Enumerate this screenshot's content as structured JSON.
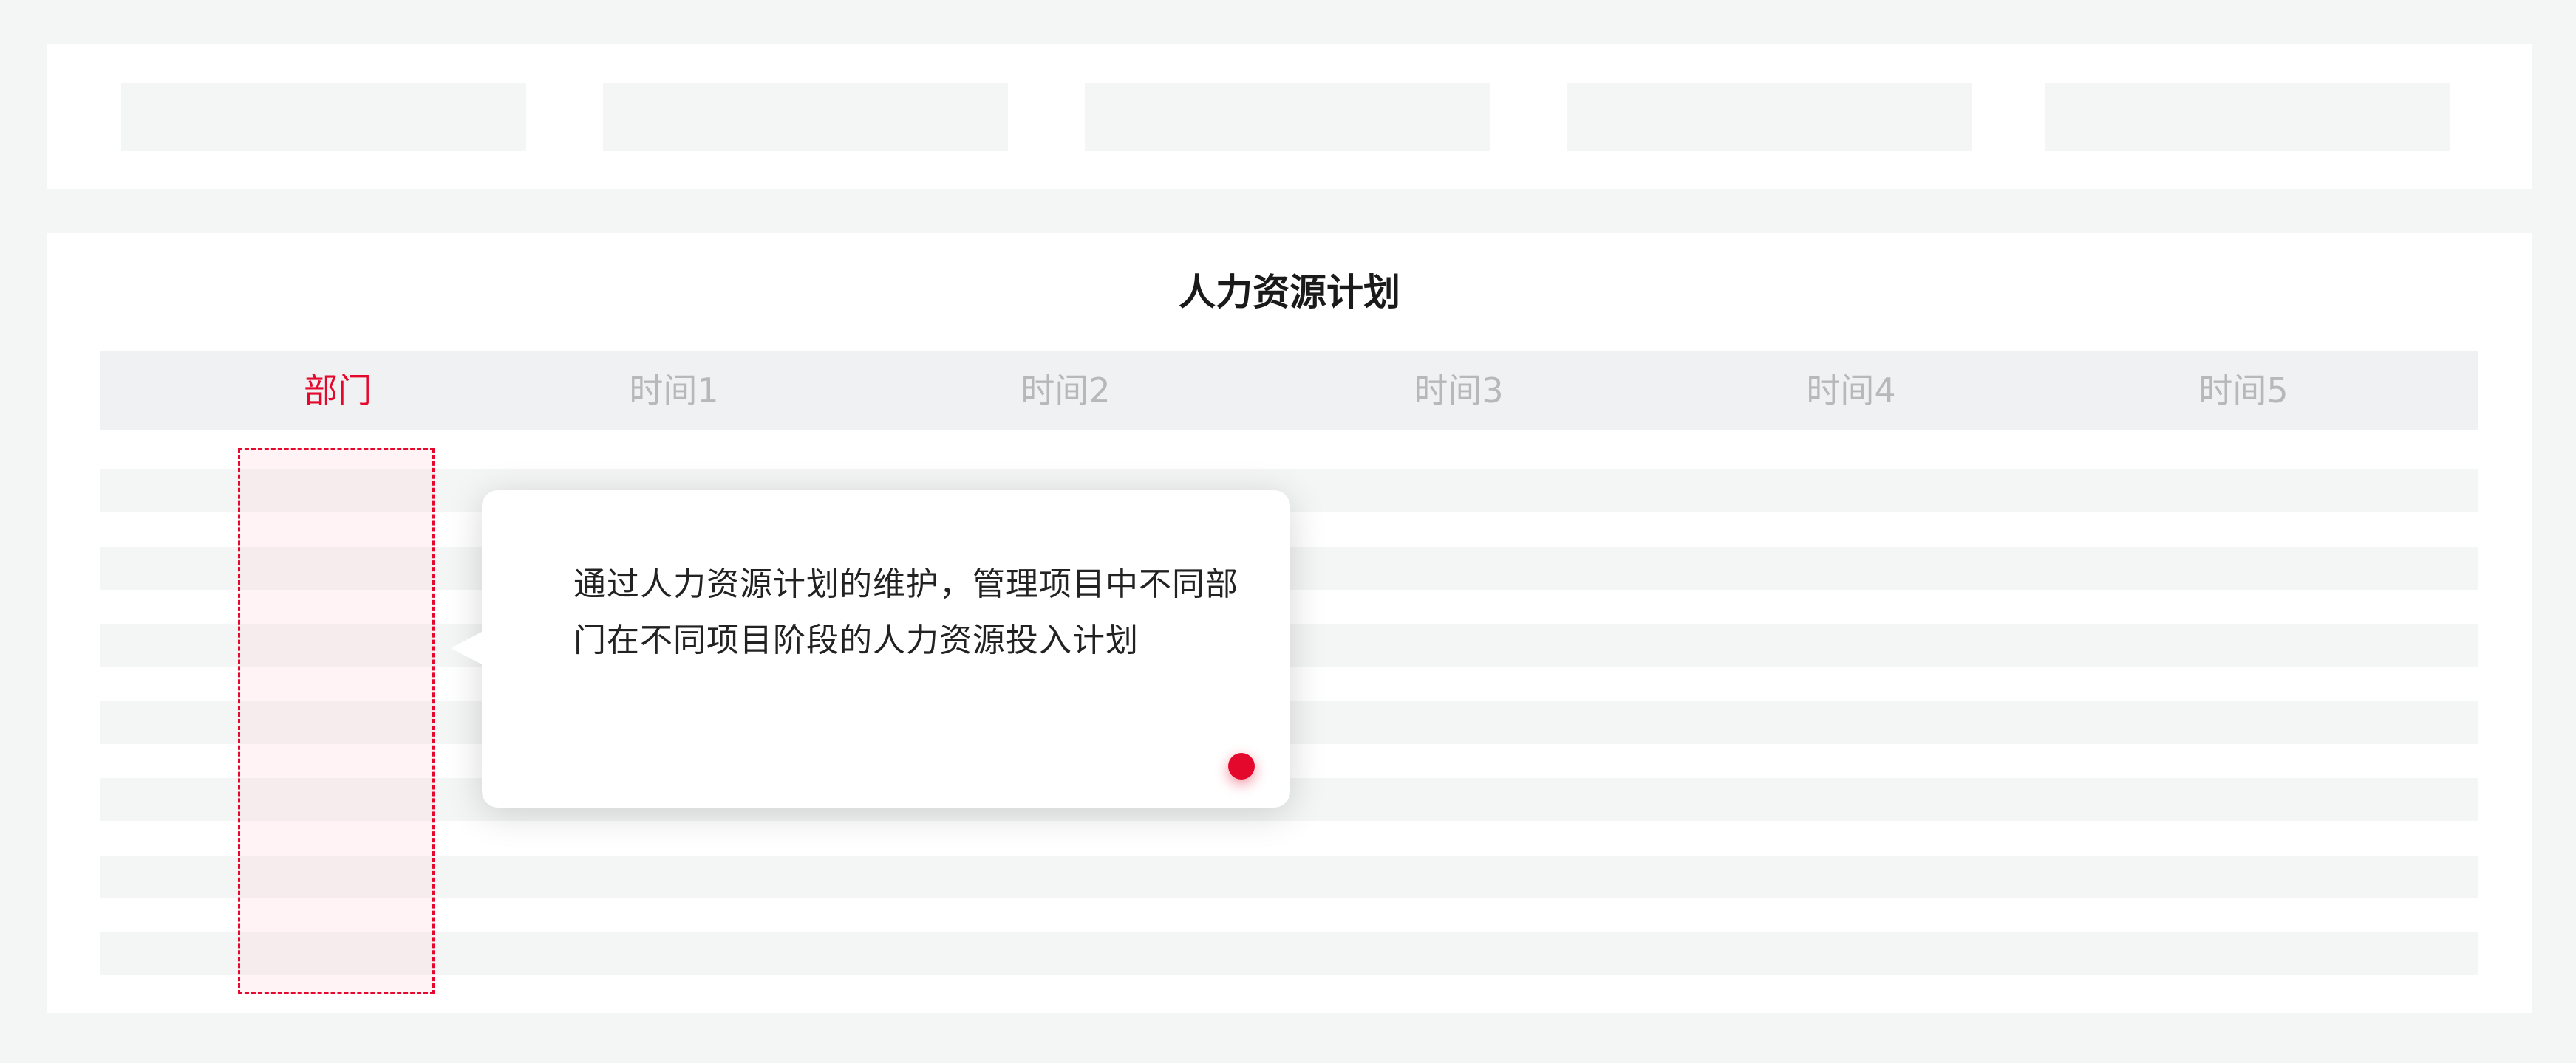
{
  "filters": [
    {
      "id": "filter-1",
      "value": ""
    },
    {
      "id": "filter-2",
      "value": ""
    },
    {
      "id": "filter-3",
      "value": ""
    },
    {
      "id": "filter-4",
      "value": ""
    },
    {
      "id": "filter-5",
      "value": ""
    }
  ],
  "table": {
    "title": "人力资源计划",
    "columns": [
      "部门",
      "时间1",
      "时间2",
      "时间3",
      "时间4",
      "时间5"
    ],
    "active_column": "部门"
  },
  "tooltip": {
    "text": "通过人力资源计划的维护，管理项目中不同部门在不同项目阶段的人力资源投入计划"
  },
  "colors": {
    "accent": "#e4082d",
    "header_text": "#b6b8bb",
    "stripe": "#f4f5f5"
  }
}
